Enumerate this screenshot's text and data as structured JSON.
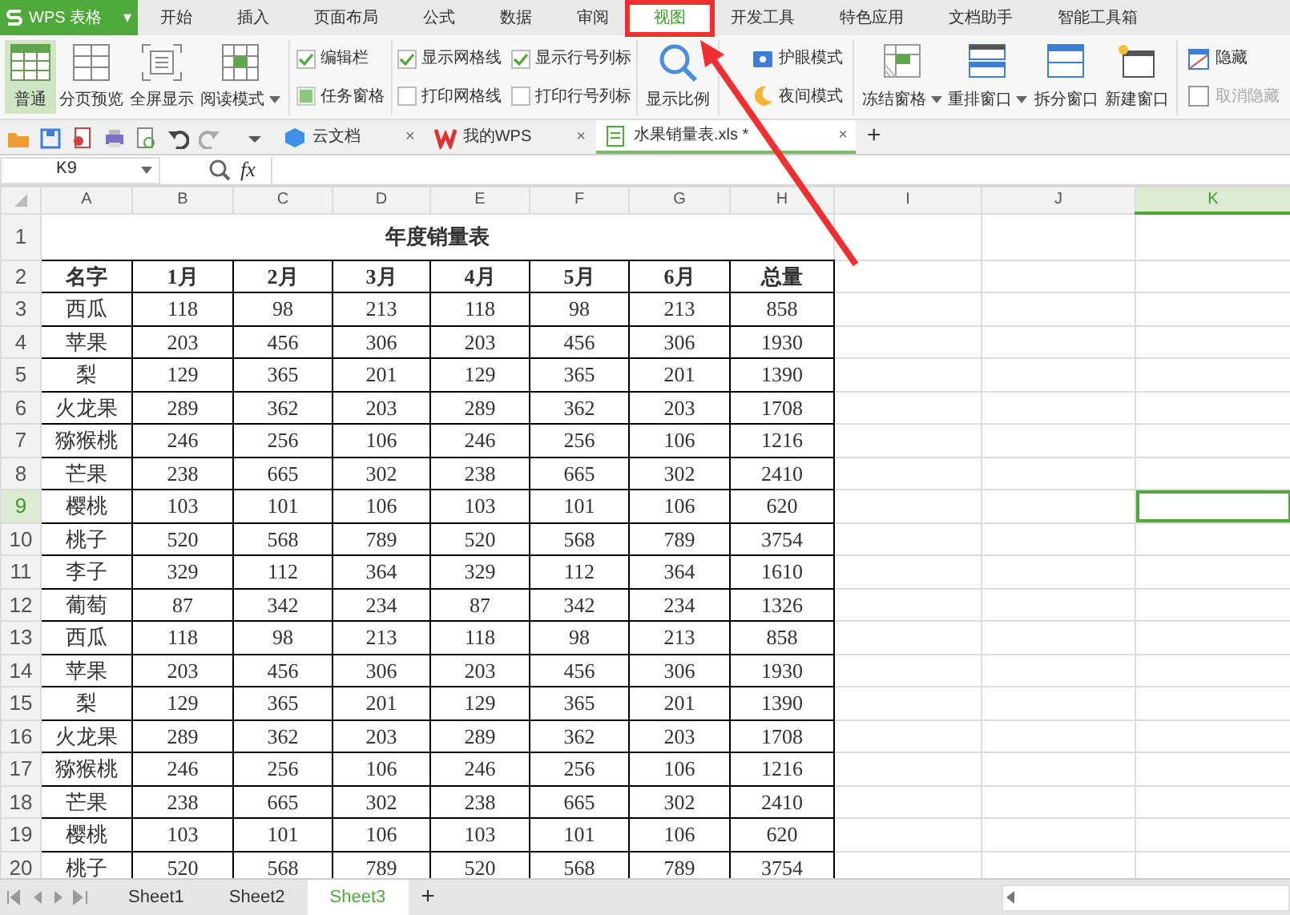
{
  "app_button": {
    "label": "WPS 表格",
    "caret": "▾"
  },
  "menu_tabs": [
    {
      "label": "开始",
      "selected": false
    },
    {
      "label": "插入",
      "selected": false
    },
    {
      "label": "页面布局",
      "selected": false
    },
    {
      "label": "公式",
      "selected": false
    },
    {
      "label": "数据",
      "selected": false
    },
    {
      "label": "审阅",
      "selected": false
    },
    {
      "label": "视图",
      "selected": true
    },
    {
      "label": "开发工具",
      "selected": false
    },
    {
      "label": "特色应用",
      "selected": false
    },
    {
      "label": "文档助手",
      "selected": false
    },
    {
      "label": "智能工具箱",
      "selected": false
    }
  ],
  "ribbon": {
    "view_modes": [
      {
        "label": "普通",
        "selected": true,
        "dropdown": false
      },
      {
        "label": "分页预览",
        "selected": false,
        "dropdown": false
      },
      {
        "label": "全屏显示",
        "selected": false,
        "dropdown": false
      },
      {
        "label": "阅读模式",
        "selected": false,
        "dropdown": true
      }
    ],
    "panes": [
      {
        "label": "编辑栏",
        "kind": "checkbox",
        "checked": true
      },
      {
        "label": "任务窗格",
        "kind": "toggle",
        "checked": true
      }
    ],
    "grid_options": [
      {
        "label": "显示网格线",
        "checked": true
      },
      {
        "label": "显示行号列标",
        "checked": true
      },
      {
        "label": "打印网格线",
        "checked": false
      },
      {
        "label": "打印行号列标",
        "checked": false
      }
    ],
    "zoom_button": {
      "label": "显示比例"
    },
    "modes": [
      {
        "label": "护眼模式"
      },
      {
        "label": "夜间模式"
      }
    ],
    "window_buttons": [
      {
        "label": "冻结窗格",
        "dropdown": true
      },
      {
        "label": "重排窗口",
        "dropdown": true
      },
      {
        "label": "拆分窗口",
        "dropdown": false
      },
      {
        "label": "新建窗口",
        "dropdown": false
      }
    ],
    "hide_buttons": [
      {
        "label": "隐藏",
        "disabled": false
      },
      {
        "label": "取消隐藏",
        "disabled": true
      }
    ]
  },
  "document_tabs": [
    {
      "label": "云文档",
      "close": "×",
      "selected": false
    },
    {
      "label": "我的WPS",
      "close": "×",
      "selected": false
    },
    {
      "label": "水果销量表.xls *",
      "close": "×",
      "selected": true
    }
  ],
  "new_tab": "+",
  "formula_bar": {
    "name_box": "K9",
    "function_label": "fx"
  },
  "sheet": {
    "columns": [
      {
        "label": "A",
        "selected": false
      },
      {
        "label": "B",
        "selected": false
      },
      {
        "label": "C",
        "selected": false
      },
      {
        "label": "D",
        "selected": false
      },
      {
        "label": "E",
        "selected": false
      },
      {
        "label": "F",
        "selected": false
      },
      {
        "label": "G",
        "selected": false
      },
      {
        "label": "H",
        "selected": false
      },
      {
        "label": "I",
        "selected": false
      },
      {
        "label": "J",
        "selected": false
      },
      {
        "label": "K",
        "selected": true
      }
    ],
    "title_row": {
      "number": "1",
      "selected": false,
      "title": "年度销量表"
    },
    "rows": [
      {
        "number": "2",
        "selected": false,
        "kind": "header",
        "cells": [
          "名字",
          "1月",
          "2月",
          "3月",
          "4月",
          "5月",
          "6月",
          "总量"
        ]
      },
      {
        "number": "3",
        "selected": false,
        "kind": "data",
        "cells": [
          "西瓜",
          "118",
          "98",
          "213",
          "118",
          "98",
          "213",
          "858"
        ]
      },
      {
        "number": "4",
        "selected": false,
        "kind": "data",
        "cells": [
          "苹果",
          "203",
          "456",
          "306",
          "203",
          "456",
          "306",
          "1930"
        ]
      },
      {
        "number": "5",
        "selected": false,
        "kind": "data",
        "cells": [
          "梨",
          "129",
          "365",
          "201",
          "129",
          "365",
          "201",
          "1390"
        ]
      },
      {
        "number": "6",
        "selected": false,
        "kind": "data",
        "cells": [
          "火龙果",
          "289",
          "362",
          "203",
          "289",
          "362",
          "203",
          "1708"
        ]
      },
      {
        "number": "7",
        "selected": false,
        "kind": "data",
        "cells": [
          "猕猴桃",
          "246",
          "256",
          "106",
          "246",
          "256",
          "106",
          "1216"
        ]
      },
      {
        "number": "8",
        "selected": false,
        "kind": "data",
        "cells": [
          "芒果",
          "238",
          "665",
          "302",
          "238",
          "665",
          "302",
          "2410"
        ]
      },
      {
        "number": "9",
        "selected": true,
        "kind": "data",
        "cells": [
          "樱桃",
          "103",
          "101",
          "106",
          "103",
          "101",
          "106",
          "620"
        ]
      },
      {
        "number": "10",
        "selected": false,
        "kind": "data",
        "cells": [
          "桃子",
          "520",
          "568",
          "789",
          "520",
          "568",
          "789",
          "3754"
        ]
      },
      {
        "number": "11",
        "selected": false,
        "kind": "data",
        "cells": [
          "李子",
          "329",
          "112",
          "364",
          "329",
          "112",
          "364",
          "1610"
        ]
      },
      {
        "number": "12",
        "selected": false,
        "kind": "data",
        "cells": [
          "葡萄",
          "87",
          "342",
          "234",
          "87",
          "342",
          "234",
          "1326"
        ]
      },
      {
        "number": "13",
        "selected": false,
        "kind": "data",
        "cells": [
          "西瓜",
          "118",
          "98",
          "213",
          "118",
          "98",
          "213",
          "858"
        ]
      },
      {
        "number": "14",
        "selected": false,
        "kind": "data",
        "cells": [
          "苹果",
          "203",
          "456",
          "306",
          "203",
          "456",
          "306",
          "1930"
        ]
      },
      {
        "number": "15",
        "selected": false,
        "kind": "data",
        "cells": [
          "梨",
          "129",
          "365",
          "201",
          "129",
          "365",
          "201",
          "1390"
        ]
      },
      {
        "number": "16",
        "selected": false,
        "kind": "data",
        "cells": [
          "火龙果",
          "289",
          "362",
          "203",
          "289",
          "362",
          "203",
          "1708"
        ]
      },
      {
        "number": "17",
        "selected": false,
        "kind": "data",
        "cells": [
          "猕猴桃",
          "246",
          "256",
          "106",
          "246",
          "256",
          "106",
          "1216"
        ]
      },
      {
        "number": "18",
        "selected": false,
        "kind": "data",
        "cells": [
          "芒果",
          "238",
          "665",
          "302",
          "238",
          "665",
          "302",
          "2410"
        ]
      },
      {
        "number": "19",
        "selected": false,
        "kind": "data",
        "cells": [
          "樱桃",
          "103",
          "101",
          "106",
          "103",
          "101",
          "106",
          "620"
        ]
      },
      {
        "number": "20",
        "selected": false,
        "kind": "data",
        "cells": [
          "桃子",
          "520",
          "568",
          "789",
          "520",
          "568",
          "789",
          "3754"
        ]
      }
    ]
  },
  "sheet_tabs": [
    {
      "label": "Sheet1",
      "selected": false
    },
    {
      "label": "Sheet2",
      "selected": false
    },
    {
      "label": "Sheet3",
      "selected": true
    }
  ],
  "add_sheet": "+"
}
